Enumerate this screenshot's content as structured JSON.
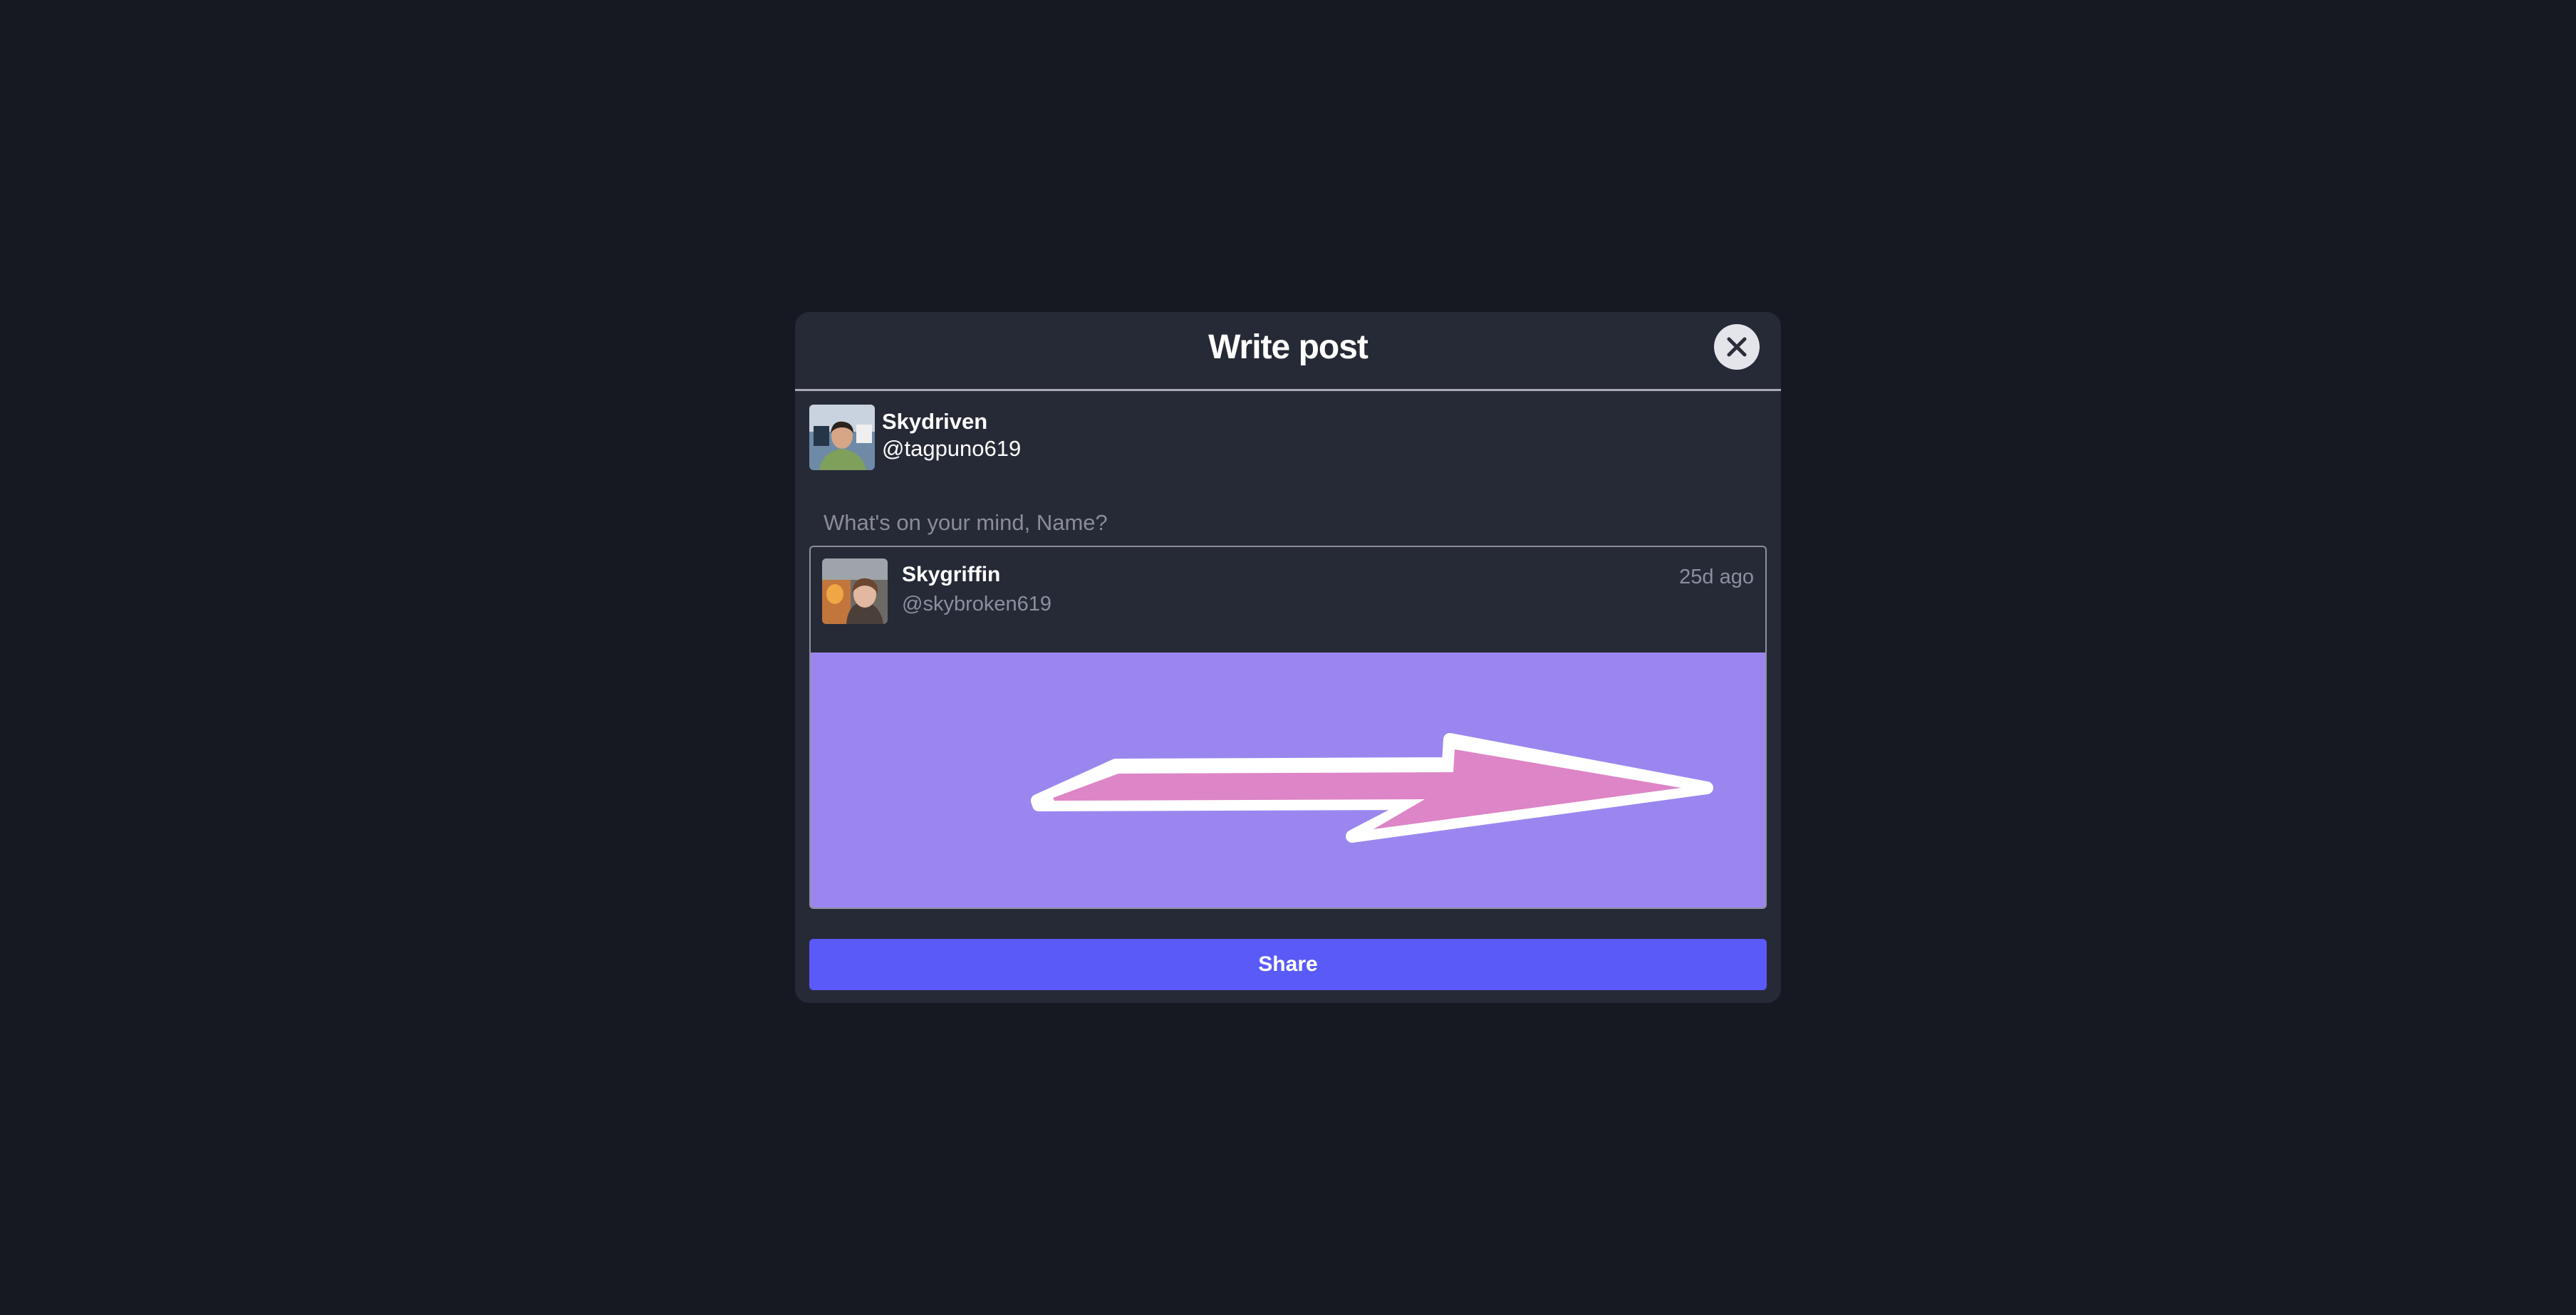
{
  "modal": {
    "title": "Write post",
    "close_icon": "close-icon"
  },
  "author": {
    "name": "Skydriven",
    "handle": "@tagpuno619"
  },
  "composer": {
    "placeholder": "What's on your mind, Name?",
    "value": ""
  },
  "quoted_post": {
    "name": "Skygriffin",
    "handle": "@skybroken619",
    "time": "25d ago",
    "image_icon": "arrow-right-image"
  },
  "actions": {
    "share_label": "Share"
  },
  "colors": {
    "background": "#171922",
    "modal": "#262a36",
    "accent": "#5a5af8",
    "image_bg": "#9b86f0",
    "arrow": "#dd85c6"
  }
}
